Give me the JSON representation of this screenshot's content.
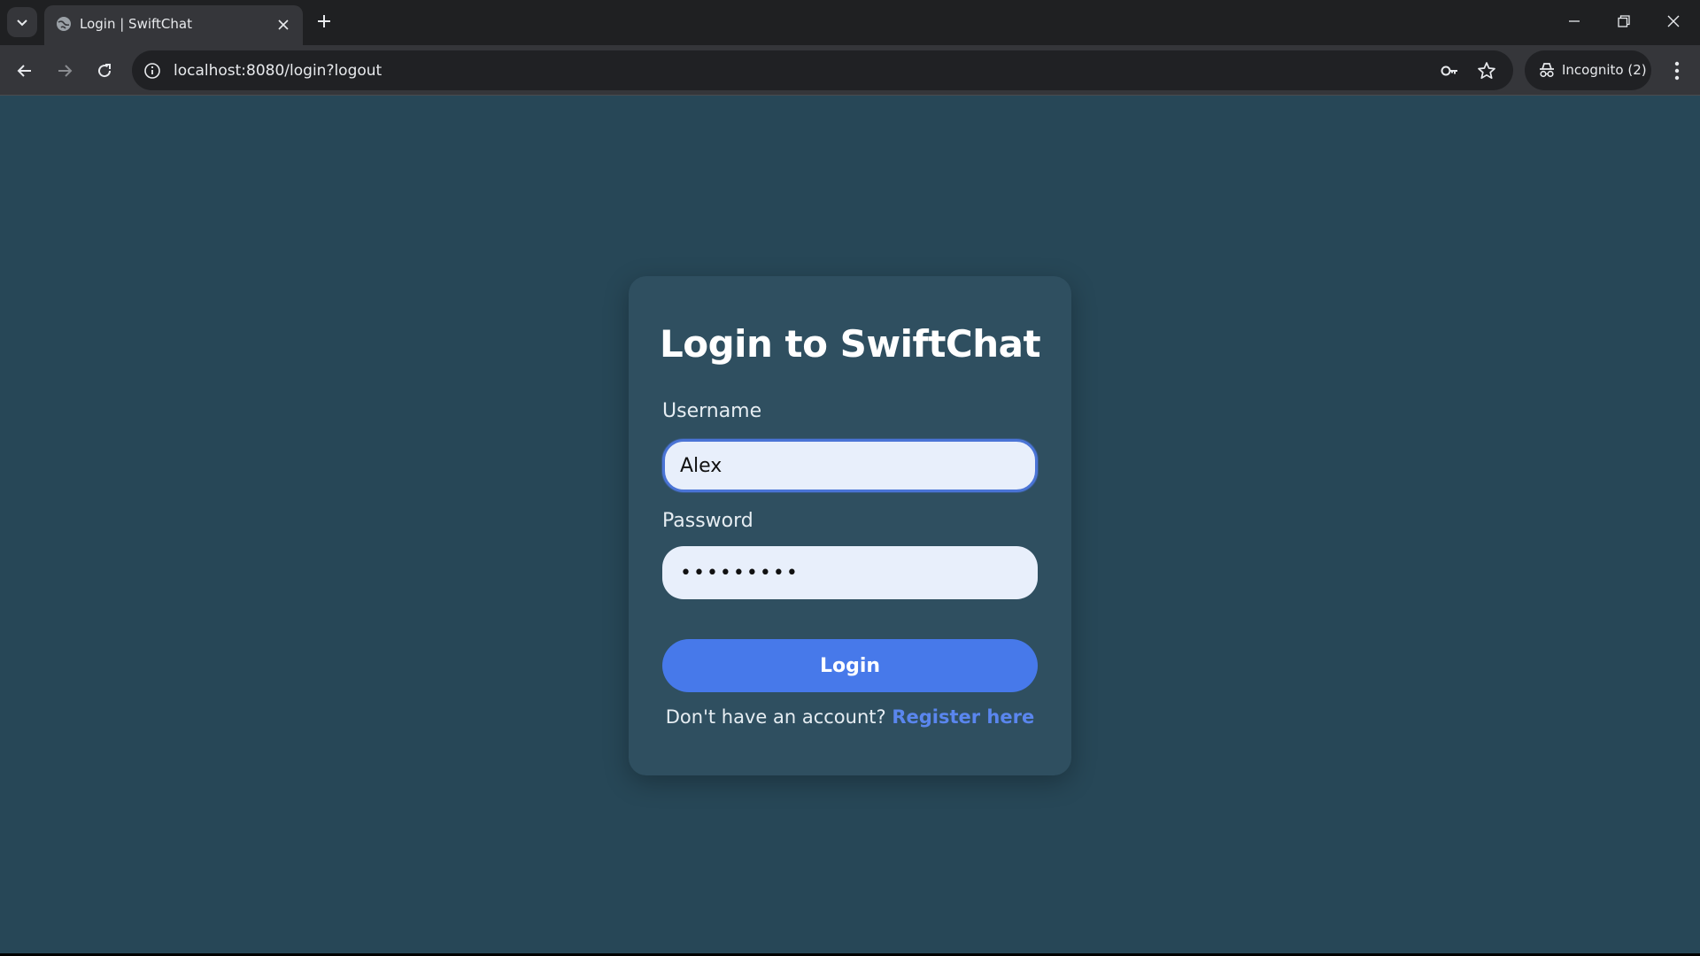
{
  "browser": {
    "tab_title": "Login | SwiftChat",
    "url": "localhost:8080/login?logout",
    "incognito_label": "Incognito (2)",
    "icons": {
      "tab_list": "chevron-down-icon",
      "favicon": "globe-icon",
      "tab_close": "close-icon",
      "new_tab": "plus-icon",
      "back": "arrow-left-icon",
      "forward": "arrow-right-icon",
      "reload": "reload-icon",
      "site_info": "info-icon",
      "password": "key-icon",
      "bookmark": "star-icon",
      "incognito": "incognito-icon",
      "menu": "kebab-menu-icon",
      "minimize": "minimize-icon",
      "restore": "restore-icon",
      "close_window": "close-icon"
    }
  },
  "login": {
    "title": "Login to SwiftChat",
    "username_label": "Username",
    "username_value": "Alex",
    "password_label": "Password",
    "password_value": "•••••••••",
    "submit_label": "Login",
    "register_prompt": "Don't have an account?",
    "register_link": "Register here"
  },
  "colors": {
    "page_background": "#274757",
    "card_background": "#2f4f60",
    "input_background": "#e8effb",
    "accent": "#4779ea",
    "link": "#5a86ee"
  }
}
